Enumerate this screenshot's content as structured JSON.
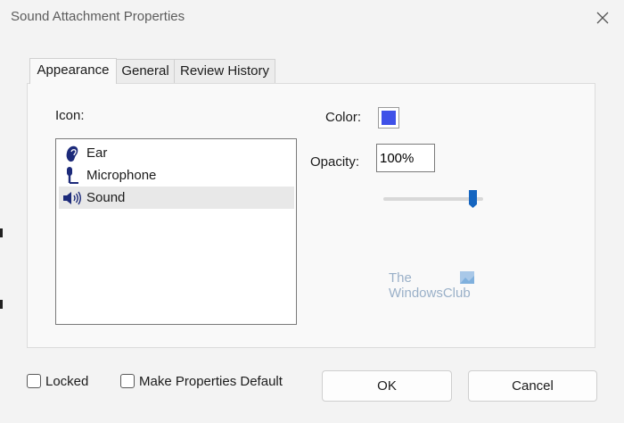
{
  "window": {
    "title": "Sound Attachment Properties"
  },
  "tabs": [
    {
      "label": "Appearance",
      "active": true
    },
    {
      "label": "General",
      "active": false
    },
    {
      "label": "Review History",
      "active": false
    }
  ],
  "appearance": {
    "icon_label": "Icon:",
    "icons": [
      {
        "label": "Ear",
        "icon": "ear-icon",
        "selected": false
      },
      {
        "label": "Microphone",
        "icon": "microphone-icon",
        "selected": false
      },
      {
        "label": "Sound",
        "icon": "speaker-icon",
        "selected": true
      }
    ],
    "color_label": "Color:",
    "color_value": "#3f51e8",
    "opacity_label": "Opacity:",
    "opacity_value": "100%",
    "opacity_slider_fraction": 1.0
  },
  "watermark": {
    "line1": "The",
    "line2": "WindowsClub"
  },
  "footer": {
    "locked_label": "Locked",
    "locked_checked": false,
    "default_label": "Make Properties Default",
    "default_checked": false,
    "ok_label": "OK",
    "cancel_label": "Cancel"
  },
  "colors": {
    "accent": "#3f51e8",
    "icon_dark_blue": "#1c2a7a",
    "slider_thumb": "#1565c0"
  }
}
